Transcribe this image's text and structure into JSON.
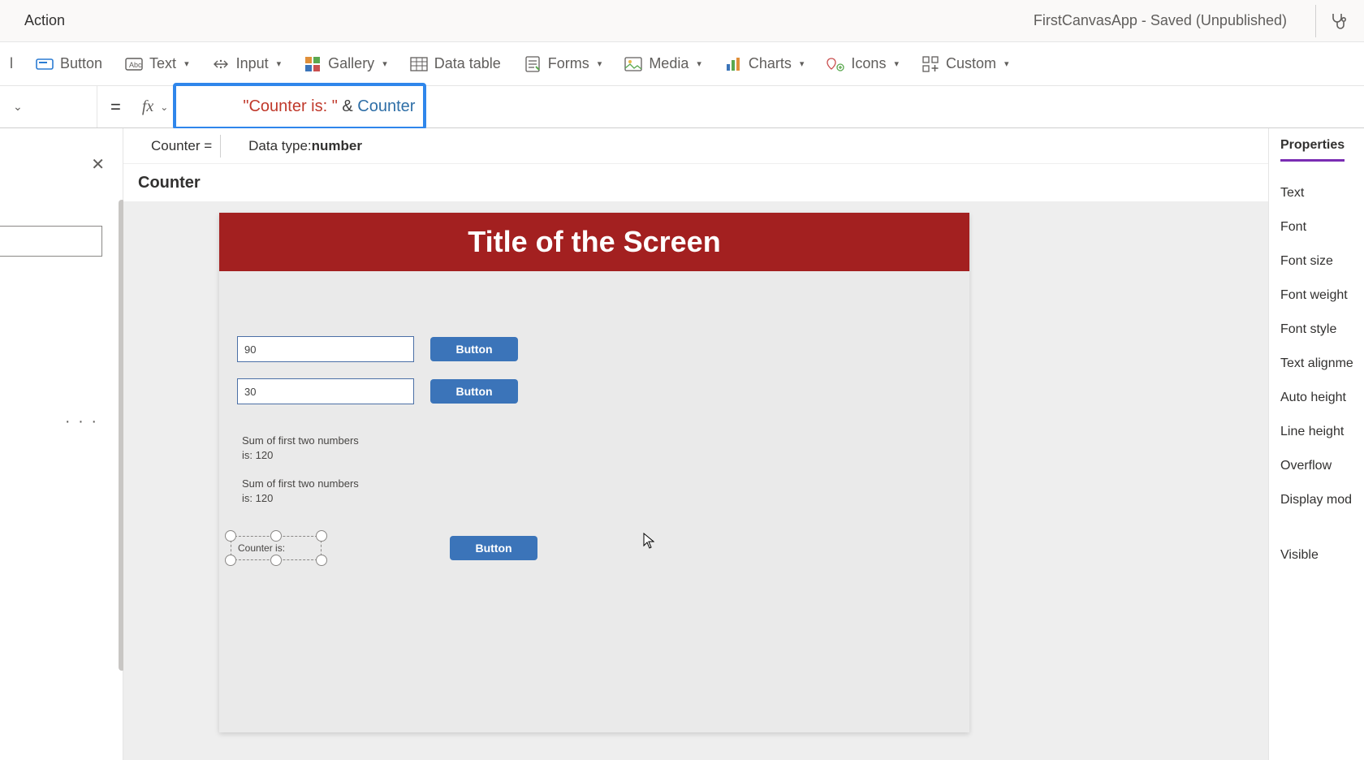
{
  "titlebar": {
    "action": "Action",
    "app_status": "FirstCanvasApp - Saved (Unpublished)"
  },
  "ribbon": {
    "label_partial": "l",
    "button": "Button",
    "text": "Text",
    "input": "Input",
    "gallery": "Gallery",
    "data_table": "Data table",
    "forms": "Forms",
    "media": "Media",
    "charts": "Charts",
    "icons": "Icons",
    "custom": "Custom"
  },
  "formula": {
    "string_part": "\"Counter is: \"",
    "operator": " & ",
    "variable": "Counter"
  },
  "intellisense": {
    "left": "Counter  =",
    "dtype_label": "Data type: ",
    "dtype_value": "number"
  },
  "breadcrumb": "Counter",
  "canvas": {
    "title": "Title of the Screen",
    "input1": "90",
    "input2": "30",
    "btn": "Button",
    "sum_label_1": "Sum of first two numbers is: 120",
    "sum_label_2": "Sum of first two numbers is: 120",
    "selected_label": "Counter is:"
  },
  "properties": {
    "tab": "Properties",
    "rows": [
      "Text",
      "Font",
      "Font size",
      "Font weight",
      "Font style",
      "Text alignme",
      "Auto height",
      "Line height",
      "Overflow",
      "Display mod",
      "Visible"
    ]
  }
}
